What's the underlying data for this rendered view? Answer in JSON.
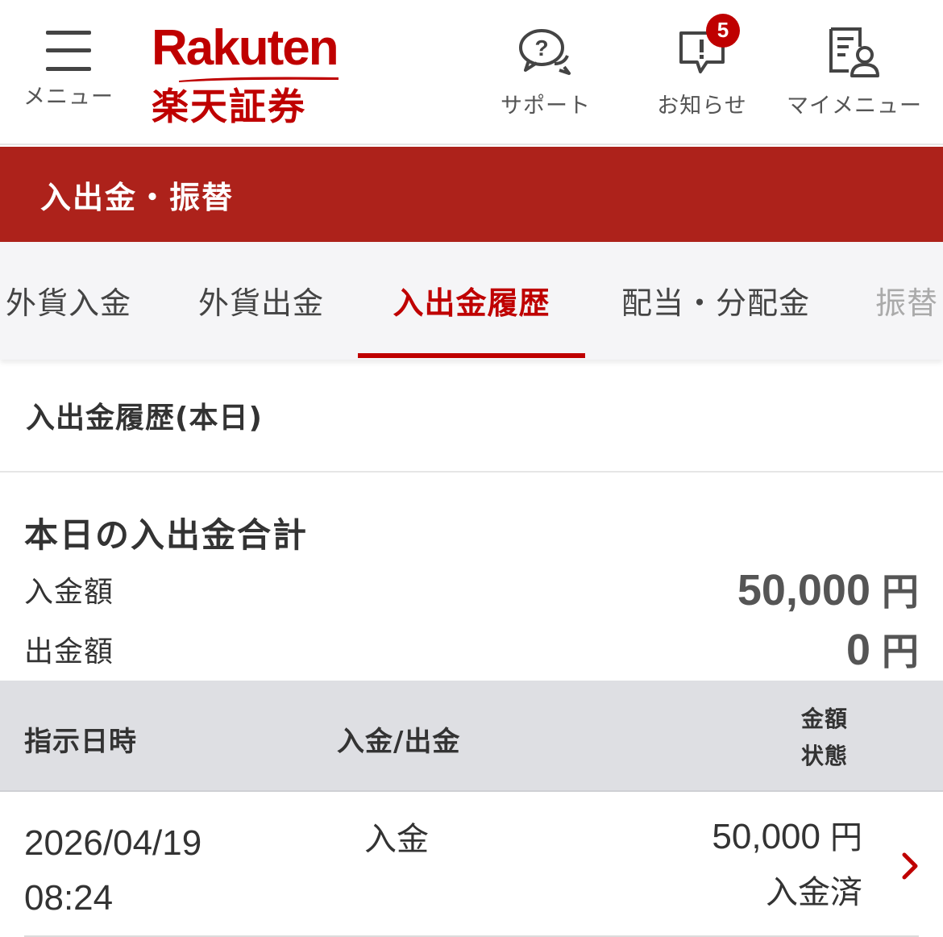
{
  "header": {
    "menu_label": "メニュー",
    "logo_en": "Rakuten",
    "logo_jp": "楽天証券",
    "support_label": "サポート",
    "news_label": "お知らせ",
    "news_badge": "5",
    "mymenu_label": "マイメニュー",
    "brand_color": "#bf0000"
  },
  "page_title": "入出金・振替",
  "tabs": [
    {
      "label": "外貨入金",
      "active": false
    },
    {
      "label": "外貨出金",
      "active": false
    },
    {
      "label": "入出金履歴",
      "active": true
    },
    {
      "label": "配当・分配金",
      "active": false
    },
    {
      "label": "振替",
      "active": false
    }
  ],
  "section_title": "入出金履歴(本日)",
  "summary": {
    "title": "本日の入出金合計",
    "deposit_label": "入金額",
    "deposit_value": "50,000",
    "withdrawal_label": "出金額",
    "withdrawal_value": "0",
    "unit": "円"
  },
  "table": {
    "headers": {
      "date": "指示日時",
      "type": "入金/出金",
      "amount": "金額",
      "status": "状態"
    },
    "rows": [
      {
        "date": "2026/04/19",
        "time": "08:24",
        "type": "入金",
        "amount": "50,000",
        "unit": "円",
        "status": "入金済"
      }
    ]
  },
  "icons": {
    "menu": "hamburger-icon",
    "support": "support-chat-icon",
    "news": "notification-icon",
    "mymenu": "my-menu-icon",
    "row": "chevron-right-icon"
  }
}
